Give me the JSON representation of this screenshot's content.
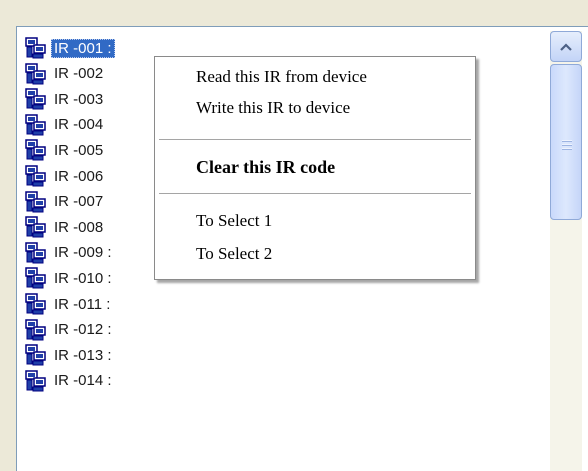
{
  "window": {
    "colors": {
      "selection": "#316ac5",
      "panel": "#ece9d8",
      "list_bg": "#ffffff"
    }
  },
  "ir_list": {
    "icon": "network-computers-icon",
    "items": [
      {
        "label": "IR -001 :",
        "selected": true
      },
      {
        "label": "IR -002"
      },
      {
        "label": "IR -003"
      },
      {
        "label": "IR -004"
      },
      {
        "label": "IR -005"
      },
      {
        "label": "IR -006"
      },
      {
        "label": "IR -007"
      },
      {
        "label": "IR -008"
      },
      {
        "label": "IR -009 :"
      },
      {
        "label": "IR -010 :"
      },
      {
        "label": "IR -011 :"
      },
      {
        "label": "IR -012 :"
      },
      {
        "label": "IR -013 :"
      },
      {
        "label": "IR -014 :"
      }
    ]
  },
  "scrollbar": {
    "up_icon": "chevron-up-icon",
    "position": 0.0
  },
  "context_menu": {
    "read": "Read this IR from device",
    "write": "Write this IR to device",
    "clear": "Clear this IR code",
    "select1": "To Select 1",
    "select2": "To Select 2"
  }
}
